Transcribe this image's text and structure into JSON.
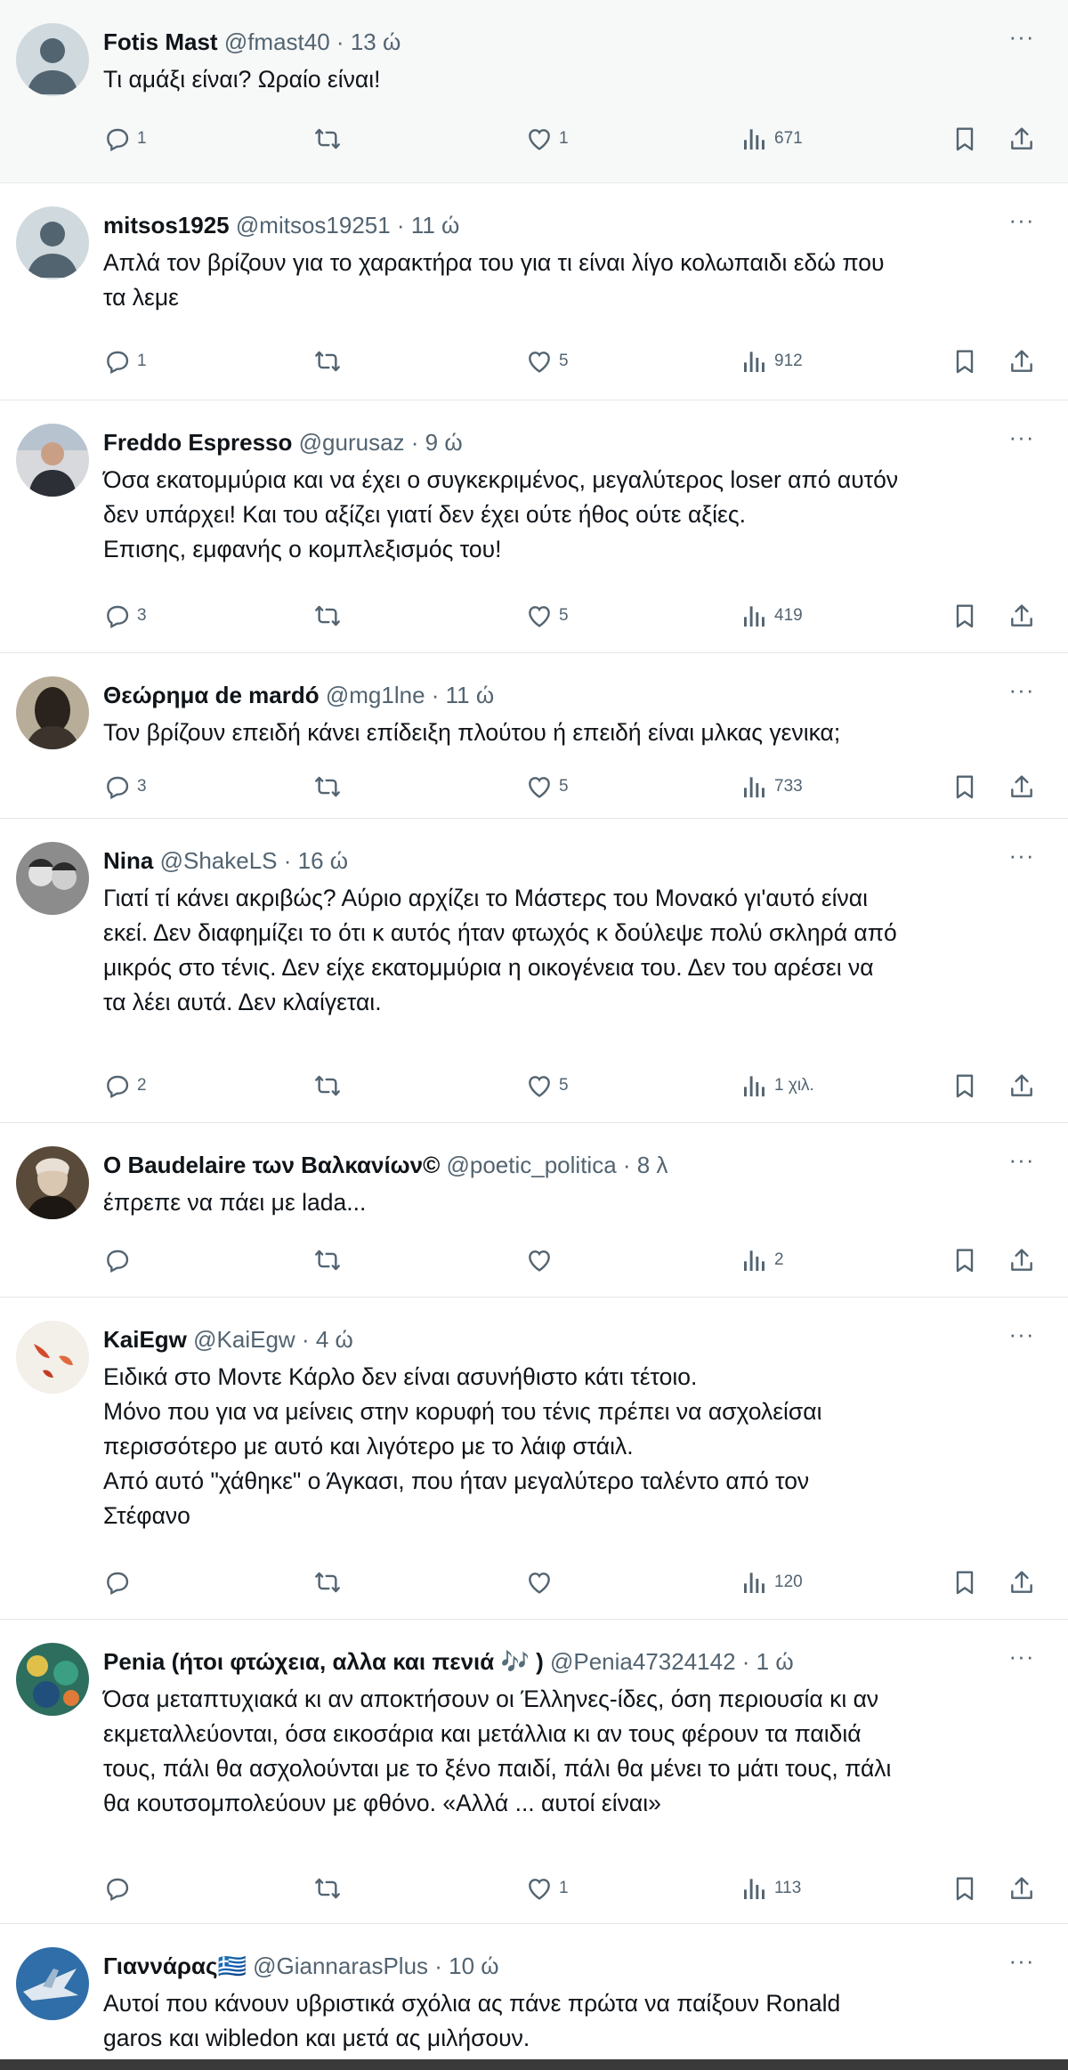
{
  "colors": {
    "text": "#0f1419",
    "muted": "#536471",
    "highlight_bg": "#f7f8f8",
    "border": "#e4e7ea"
  },
  "icons": [
    "reply-icon",
    "retweet-icon",
    "like-icon",
    "views-icon",
    "bookmark-icon",
    "share-icon",
    "more-icon"
  ],
  "tweets": [
    {
      "name": "Fotis Mast",
      "handle": "@fmast40",
      "time": "13 ώ",
      "text": [
        "Τι αμάξι είναι? Ωραίο είναι!"
      ],
      "replies": "1",
      "retweets": "",
      "likes": "1",
      "views": "671"
    },
    {
      "name": "mitsos1925",
      "handle": "@mitsos19251",
      "time": "11 ώ",
      "text": [
        "Απλά τον βρίζουν για το χαρακτήρα του για τι είναι λίγο κολωπαιδι εδώ που",
        "τα λεμε"
      ],
      "replies": "1",
      "retweets": "",
      "likes": "5",
      "views": "912"
    },
    {
      "name": "Freddo Espresso",
      "handle": "@gurusaz",
      "time": "9 ώ",
      "text": [
        "Όσα εκατομμύρια και να έχει ο συγκεκριμένος, μεγαλύτερος loser από αυτόν",
        "δεν υπάρχει! Και του αξίζει γιατί δεν έχει ούτε ήθος ούτε αξίες.",
        "Επισης, εμφανής ο κομπλεξισμός του!"
      ],
      "replies": "3",
      "retweets": "",
      "likes": "5",
      "views": "419"
    },
    {
      "name": "Θεώρημα de mardó",
      "handle": "@mg1lne",
      "time": "11 ώ",
      "text": [
        "Τον βρίζουν επειδή κάνει επίδειξη πλούτου ή επειδή είναι μλκας γενικα;"
      ],
      "replies": "3",
      "retweets": "",
      "likes": "5",
      "views": "733"
    },
    {
      "name": "Nina",
      "handle": "@ShakeLS",
      "time": "16 ώ",
      "text": [
        "Γιατί τί κάνει ακριβώς? Αύριο αρχίζει το Μάστερς του Μονακό γι'αυτό είναι",
        "εκεί. Δεν διαφημίζει το ότι κ αυτός ήταν φτωχός κ δούλεψε πολύ σκληρά από",
        "μικρός στο τένις. Δεν είχε εκατομμύρια η οικογένεια του. Δεν του αρέσει να",
        "τα λέει αυτά. Δεν κλαίγεται."
      ],
      "replies": "2",
      "retweets": "",
      "likes": "5",
      "views": "1 χιλ."
    },
    {
      "name": "O Baudelaire των Βαλκανίων©",
      "handle": "@poetic_politica",
      "time": "8 λ",
      "text": [
        "έπρεπε να πάει με lada..."
      ],
      "replies": "",
      "retweets": "",
      "likes": "",
      "views": "2"
    },
    {
      "name": "KaiEgw",
      "handle": "@KaiEgw",
      "time": "4 ώ",
      "text": [
        "Ειδικά στο Μοντε Κάρλο δεν είναι ασυνήθιστο κάτι τέτοιο.",
        "Μόνο που για να μείνεις στην κορυφή του τένις πρέπει να ασχολείσαι",
        "περισσότερο με αυτό και λιγότερο με το λάιφ στάιλ.",
        "Από αυτό \"χάθηκε\" ο Άγκασι, που ήταν μεγαλύτερο ταλέντο από τον",
        "Στέφανο"
      ],
      "replies": "",
      "retweets": "",
      "likes": "",
      "views": "120"
    },
    {
      "name": "Penia (ήτοι φτώχεια, αλλα και πενιά 🎶 )",
      "handle": "@Penia47324142",
      "time": "1 ώ",
      "text": [
        "Όσα μεταπτυχιακά κι αν αποκτήσουν οι Έλληνες-ίδες, όση περιουσία κι αν",
        "εκμεταλλεύονται, όσα εικοσάρια και μετάλλια κι αν τους φέρουν τα παιδιά",
        "τους, πάλι θα ασχολούνται με το ξένο παιδί, πάλι θα μένει το μάτι τους, πάλι",
        "θα κουτσομπολεύουν με φθόνο. «Αλλά ... αυτοί είναι»"
      ],
      "replies": "",
      "retweets": "",
      "likes": "1",
      "views": "113"
    },
    {
      "name": "Γιαννάρας🇬🇷",
      "handle": "@GiannarasPlus",
      "time": "10 ώ",
      "text": [
        "Αυτοί που κάνουν υβριστικά σχόλια ας πάνε πρώτα να παίξουν Ronald",
        "garos και wibledon και μετά ας μιλήσουν."
      ],
      "replies": "",
      "retweets": "",
      "likes": "",
      "views": ""
    }
  ]
}
